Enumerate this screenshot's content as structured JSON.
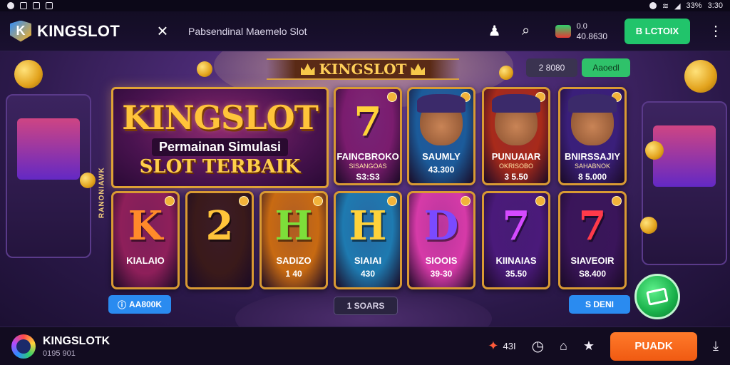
{
  "status_bar": {
    "battery": "33%",
    "time": "3:30"
  },
  "app": {
    "brand": "KINGSLOT",
    "logo_letter": "K",
    "page_label": "Pabsendinal Maemelo Slot"
  },
  "top": {
    "balance_label": "0.0",
    "balance_amount": "40.8630",
    "cta_label": "B LCTOIX"
  },
  "banner": {
    "title": "KINGSLOT"
  },
  "mini_buttons": {
    "left": "2 8080",
    "right": "Aaoedl"
  },
  "hero": {
    "title": "KINGSLOT",
    "subtitle": "Permainan Simulasi",
    "subtitle2": "SLOT TERBAIK"
  },
  "side_ribbon": "RANONIAWK",
  "cards": [
    {
      "art": "7",
      "name": "FAINCBROKO",
      "sub": "SISANGOAS",
      "price": "S3:S3",
      "bg": "#7a1c6e",
      "art_color": "#ffd23a"
    },
    {
      "art": "face",
      "name": "SAUMLY",
      "sub": "",
      "price": "43.300",
      "bg": "#1b5b9a",
      "art_color": "#ffd23a"
    },
    {
      "art": "face",
      "name": "PUNUAIAR",
      "sub": "OKRISOBO",
      "price": "3 5.50",
      "bg": "#a82a1a",
      "art_color": "#ffd23a"
    },
    {
      "art": "face",
      "name": "BNIRSSAJIY",
      "sub": "SAHABNOK",
      "price": "8 5.000",
      "bg": "#3a1f7a",
      "art_color": "#ffd23a"
    },
    {
      "art": "K",
      "name": "KIALAIO",
      "sub": "",
      "price": "",
      "bg": "#8e1f5a",
      "art_color": "#ff8a2a"
    },
    {
      "art": "2",
      "name": "",
      "sub": "",
      "price": "",
      "bg": "#3a1a1a",
      "art_color": "#ffc43a"
    },
    {
      "art": "H",
      "name": "SADIZO",
      "sub": "",
      "price": "1 40",
      "bg": "#c86a12",
      "art_color": "#7ddf3a"
    },
    {
      "art": "H",
      "name": "SIAIAI",
      "sub": "",
      "price": "430",
      "bg": "#1e7ab0",
      "art_color": "#ffd23a"
    },
    {
      "art": "D",
      "name": "SIOOIS",
      "sub": "",
      "price": "39-30",
      "bg": "#d63aa8",
      "art_color": "#7a4aff"
    },
    {
      "art": "7",
      "name": "KIINAIAS",
      "sub": "",
      "price": "35.50",
      "bg": "#4a1a7a",
      "art_color": "#d44aff"
    },
    {
      "art": "7",
      "name": "SIAVEOIR",
      "sub": "",
      "price": "S8.400",
      "bg": "#3a155a",
      "art_color": "#ff3a4a"
    }
  ],
  "room_buttons": {
    "left": "AA800K",
    "center": "1 SOARS",
    "right": "S DENI"
  },
  "bottom": {
    "user_name": "KINGSLOTK",
    "user_id": "0195 901",
    "stat": "43I",
    "cta_label": "PUADK"
  }
}
